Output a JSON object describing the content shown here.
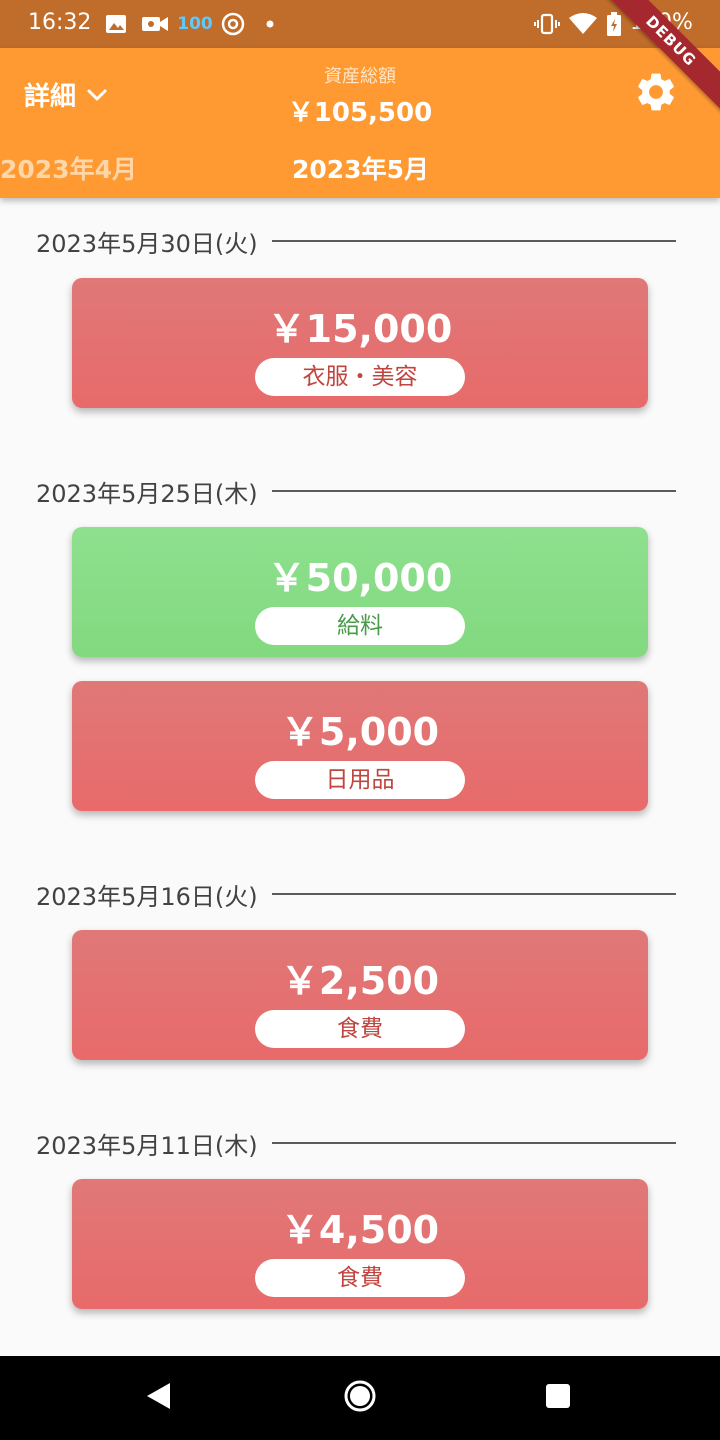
{
  "status_bar": {
    "time": "16:32",
    "speed_badge": "100",
    "battery": "100%"
  },
  "debug_banner": "DEBUG",
  "app_bar": {
    "view_mode": "詳細",
    "total_label": "資産総額",
    "total_value": "￥105,500",
    "prev_month": "2023年4月",
    "current_month": "2023年5月"
  },
  "days": [
    {
      "date": "2023年5月30日(火)",
      "entries": [
        {
          "amount": "￥15,000",
          "category": "衣服・美容",
          "kind": "expense"
        }
      ]
    },
    {
      "date": "2023年5月25日(木)",
      "entries": [
        {
          "amount": "￥50,000",
          "category": "給料",
          "kind": "income"
        },
        {
          "amount": "￥5,000",
          "category": "日用品",
          "kind": "expense"
        }
      ]
    },
    {
      "date": "2023年5月16日(火)",
      "entries": [
        {
          "amount": "￥2,500",
          "category": "食費",
          "kind": "expense"
        }
      ]
    },
    {
      "date": "2023年5月11日(木)",
      "entries": [
        {
          "amount": "￥4,500",
          "category": "食費",
          "kind": "expense"
        }
      ]
    }
  ],
  "colors": {
    "app_bar": "#ff9a33",
    "status_bar": "#c06c2a",
    "expense_card": "#e57373",
    "income_card": "#86dc84"
  }
}
